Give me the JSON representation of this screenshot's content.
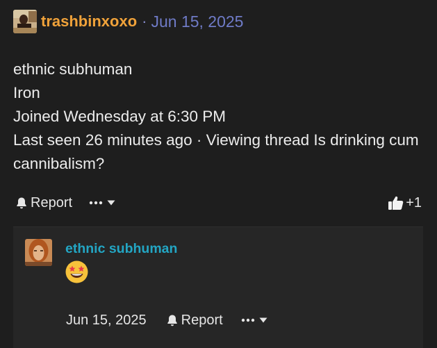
{
  "post": {
    "author": "trashbinxoxo",
    "separator": "·",
    "date": "Jun 15, 2025",
    "lines": [
      "ethnic subhuman",
      "Iron",
      "Joined Wednesday at 6:30 PM",
      "Last seen 26 minutes ago · Viewing thread Is drinking cum cannibalism?"
    ],
    "actions": {
      "report_label": "Report",
      "like_count": "+1"
    }
  },
  "reply": {
    "author": "ethnic subhuman",
    "date": "Jun 15, 2025",
    "report_label": "Report"
  },
  "colors": {
    "background": "#1e1e1e",
    "reply_background": "#262626",
    "author_orange": "#f0a23a",
    "date_blue": "#6f7bc7",
    "reply_author_cyan": "#23a6c4"
  },
  "icons": [
    "bell-icon",
    "more-dots-icon",
    "caret-down-icon",
    "thumbs-up-icon",
    "star-struck-emoji"
  ]
}
